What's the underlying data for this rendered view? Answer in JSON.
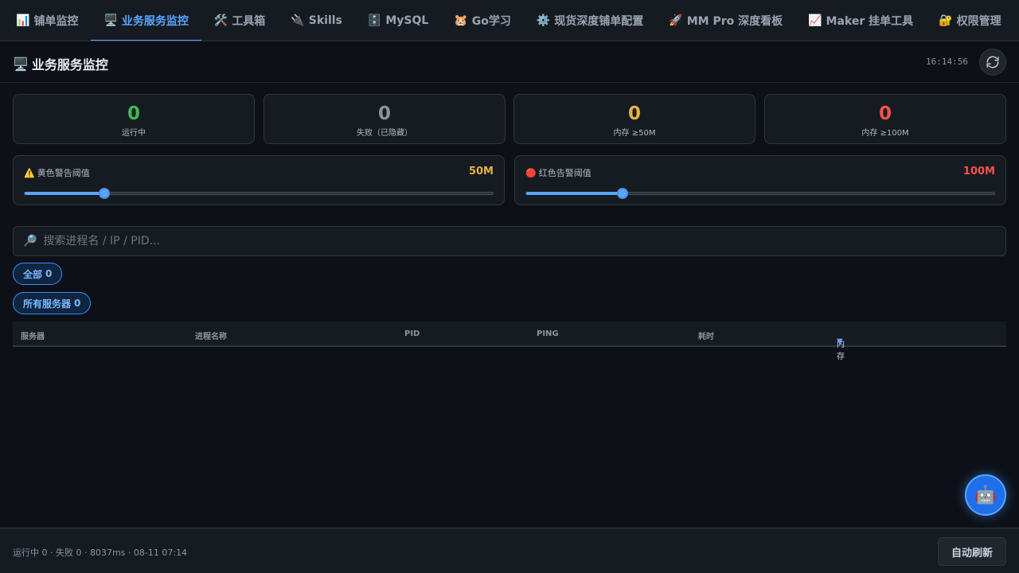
{
  "tabs": [
    {
      "icon": "📊",
      "label": "铺单监控",
      "active": false
    },
    {
      "icon": "🖥️",
      "label": "业务服务监控",
      "active": true
    },
    {
      "icon": "🛠️",
      "label": "工具箱",
      "active": false
    },
    {
      "icon": "🔌",
      "label": "Skills",
      "active": false
    },
    {
      "icon": "🗄️",
      "label": "MySQL",
      "active": false
    },
    {
      "icon": "🐹",
      "label": "Go学习",
      "active": false
    },
    {
      "icon": "⚙️",
      "label": "现货深度铺单配置",
      "active": false
    },
    {
      "icon": "🚀",
      "label": "MM Pro 深度看板",
      "active": false
    },
    {
      "icon": "📈",
      "label": "Maker 挂单工具",
      "active": false
    },
    {
      "icon": "🔐",
      "label": "权限管理",
      "active": false
    }
  ],
  "header": {
    "icon": "🖥️",
    "title": "业务服务监控",
    "time": "16:14:56",
    "refresh_icon": "refresh-icon"
  },
  "stats": [
    {
      "value": "0",
      "label": "运行中",
      "color": "#3fb950"
    },
    {
      "value": "0",
      "label": "失败（已隐藏）",
      "color": "#8b949e"
    },
    {
      "value": "0",
      "label": "内存 ≥50M",
      "color": "#e3b341"
    },
    {
      "value": "0",
      "label": "内存 ≥100M",
      "color": "#f85149"
    }
  ],
  "thresholds": {
    "yellow": {
      "icon": "⚠️",
      "label": "黄色警告阈值",
      "value_text": "50M",
      "color": "#e3b341",
      "level": 0.17
    },
    "red": {
      "icon": "🔴",
      "label": "红色告警阈值",
      "value_text": "100M",
      "color": "#f85149",
      "level": 0.205
    }
  },
  "search": {
    "icon": "🔎",
    "placeholder": "搜索进程名 / IP / PID...",
    "value": ""
  },
  "filters": {
    "status": {
      "label": "全部",
      "count": "0"
    },
    "server": {
      "label": "所有服务器",
      "count": "0"
    }
  },
  "table": {
    "columns": [
      "服务器",
      "进程名称",
      "PID",
      "PING",
      "耗时",
      "内存"
    ],
    "sort_indicator": "▼",
    "rows": []
  },
  "fab": {
    "icon": "🤖"
  },
  "footer": {
    "status": "运行中 0 · 失败 0 · 8037ms · 08-11 07:14",
    "auto_refresh_label": "自动刷新"
  },
  "colors": {
    "accent": "#58a6ff",
    "background": "#0d1117",
    "panel": "#161b22"
  }
}
